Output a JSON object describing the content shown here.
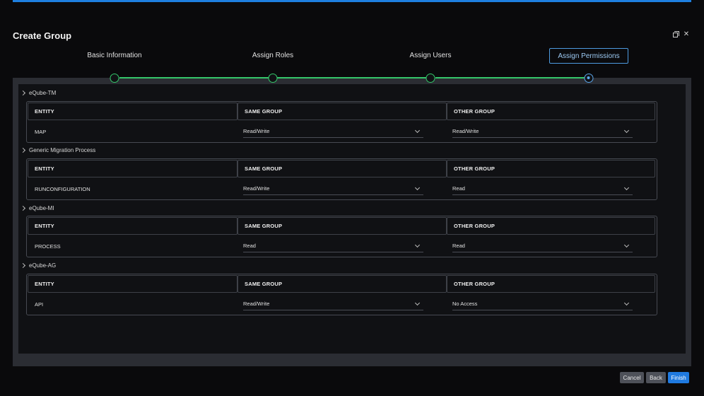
{
  "dialog": {
    "title": "Create Group"
  },
  "steps": [
    {
      "label": "Basic Information"
    },
    {
      "label": "Assign Roles"
    },
    {
      "label": "Assign Users"
    },
    {
      "label": "Assign Permissions",
      "active": true
    }
  ],
  "groups": [
    {
      "name": "eQube-TM",
      "headers": [
        "ENTITY",
        "SAME GROUP",
        "OTHER GROUP"
      ],
      "row": {
        "entity": "MAP",
        "same_group": "Read/Write",
        "other_group": "Read/Write"
      }
    },
    {
      "name": "Generic Migration Process",
      "headers": [
        "ENTITY",
        "SAME GROUP",
        "OTHER GROUP"
      ],
      "row": {
        "entity": "RUNCONFIGURATION",
        "same_group": "Read/Write",
        "other_group": "Read"
      }
    },
    {
      "name": "eQube-MI",
      "headers": [
        "ENTITY",
        "SAME GROUP",
        "OTHER GROUP"
      ],
      "row": {
        "entity": "PROCESS",
        "same_group": "Read",
        "other_group": "Read"
      }
    },
    {
      "name": "eQube-AG",
      "headers": [
        "ENTITY",
        "SAME GROUP",
        "OTHER GROUP"
      ],
      "row": {
        "entity": "API",
        "same_group": "Read/Write",
        "other_group": "No Access"
      }
    }
  ],
  "footer": {
    "cancel_label": "Cancel",
    "back_label": "Back",
    "finish_label": "Finish"
  },
  "colors": {
    "accent": "#1f7ae0",
    "step_complete": "#34c76a",
    "step_current": "#5aa6ea"
  },
  "icons": {
    "restore": "restore-icon",
    "close": "close-icon",
    "expand": "chevron-right-icon",
    "dropdown": "chevron-down-icon"
  }
}
